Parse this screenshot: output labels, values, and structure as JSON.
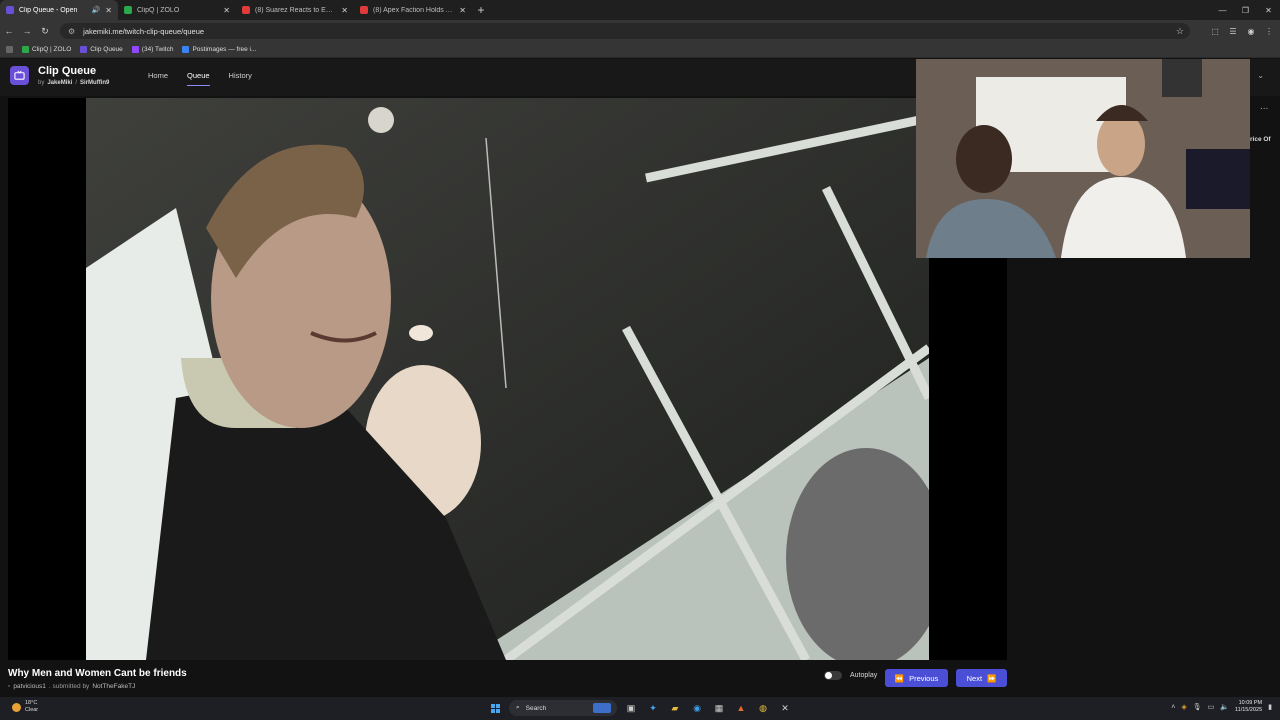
{
  "browser": {
    "tabs": [
      {
        "title": "Clip Queue - Open",
        "active": true,
        "color": "#6a4fd8"
      },
      {
        "title": "ClipQ | ZOLO",
        "active": false,
        "color": "#2aa84a"
      },
      {
        "title": "(8) Suarez Reacts to Epic 2 Gan",
        "active": false,
        "color": "#e03a3a"
      },
      {
        "title": "(8) Apex Faction Holds A Meeti",
        "active": false,
        "color": "#e03a3a"
      }
    ],
    "url": "jakemiki.me/twitch-clip-queue/queue",
    "bookmarks": [
      "ClipQ | ZOLO",
      "Clip Queue",
      "(34) Twitch",
      "Postimages — free i..."
    ]
  },
  "app": {
    "title": "Clip Queue",
    "by": "by",
    "author1": "JakeMiki",
    "sep": "/",
    "author2": "SirMuffin9",
    "nav": [
      "Home",
      "Queue",
      "History"
    ],
    "active_nav": "Queue",
    "accent": "#4b4fd6"
  },
  "side": {
    "dots": "...",
    "text": "rice Of"
  },
  "clip": {
    "title": "Why Men and Women Cant be friends",
    "channel": "patvicious1",
    "submitted_prefix": ". submitted by",
    "submitter": "NotTheFakeTJ"
  },
  "controls": {
    "autoplay_label": "Autoplay",
    "autoplay_on": false,
    "previous": "Previous",
    "next": "Next"
  },
  "taskbar": {
    "temp": "18°C",
    "condition": "Clear",
    "search": "Search",
    "time": "10:09 PM",
    "date": "11/15/2025"
  }
}
